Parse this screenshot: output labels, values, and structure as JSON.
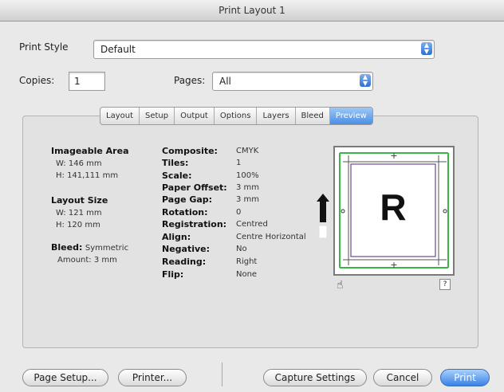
{
  "window": {
    "title": "Print Layout 1"
  },
  "print_style": {
    "label": "Print Style",
    "value": "Default"
  },
  "copies": {
    "label": "Copies:",
    "value": "1"
  },
  "pages": {
    "label": "Pages:",
    "value": "All"
  },
  "tabs": [
    {
      "label": "Layout"
    },
    {
      "label": "Setup"
    },
    {
      "label": "Output"
    },
    {
      "label": "Options"
    },
    {
      "label": "Layers"
    },
    {
      "label": "Bleed"
    },
    {
      "label": "Preview",
      "active": true
    }
  ],
  "left_info": {
    "imageable_area": "Imageable Area",
    "ia_width": "W: 146 mm",
    "ia_height": "H: 141,111 mm",
    "layout_size": "Layout Size",
    "ls_width": "W: 121 mm",
    "ls_height": "H: 120 mm",
    "bleed_label": "Bleed:",
    "bleed_value": "Symmetric",
    "amount": "Amount: 3 mm"
  },
  "details": [
    {
      "label": "Composite:",
      "value": "CMYK"
    },
    {
      "label": "Tiles:",
      "value": "1"
    },
    {
      "label": "Scale:",
      "value": "100%"
    },
    {
      "label": "Paper Offset:",
      "value": "3 mm"
    },
    {
      "label": "Page Gap:",
      "value": "3 mm"
    },
    {
      "label": "Rotation:",
      "value": "0"
    },
    {
      "label": "Registration:",
      "value": "Centred"
    },
    {
      "label": "Align:",
      "value": "Centre Horizontal"
    },
    {
      "label": "Negative:",
      "value": "No"
    },
    {
      "label": "Reading:",
      "value": "Right"
    },
    {
      "label": "Flip:",
      "value": "None"
    }
  ],
  "preview": {
    "letter": "R",
    "help": "?"
  },
  "buttons": {
    "page_setup": "Page Setup...",
    "printer": "Printer...",
    "capture": "Capture Settings",
    "cancel": "Cancel",
    "print": "Print"
  },
  "colors": {
    "accent": "#3a82e6",
    "crop_green": "#39b54a"
  }
}
